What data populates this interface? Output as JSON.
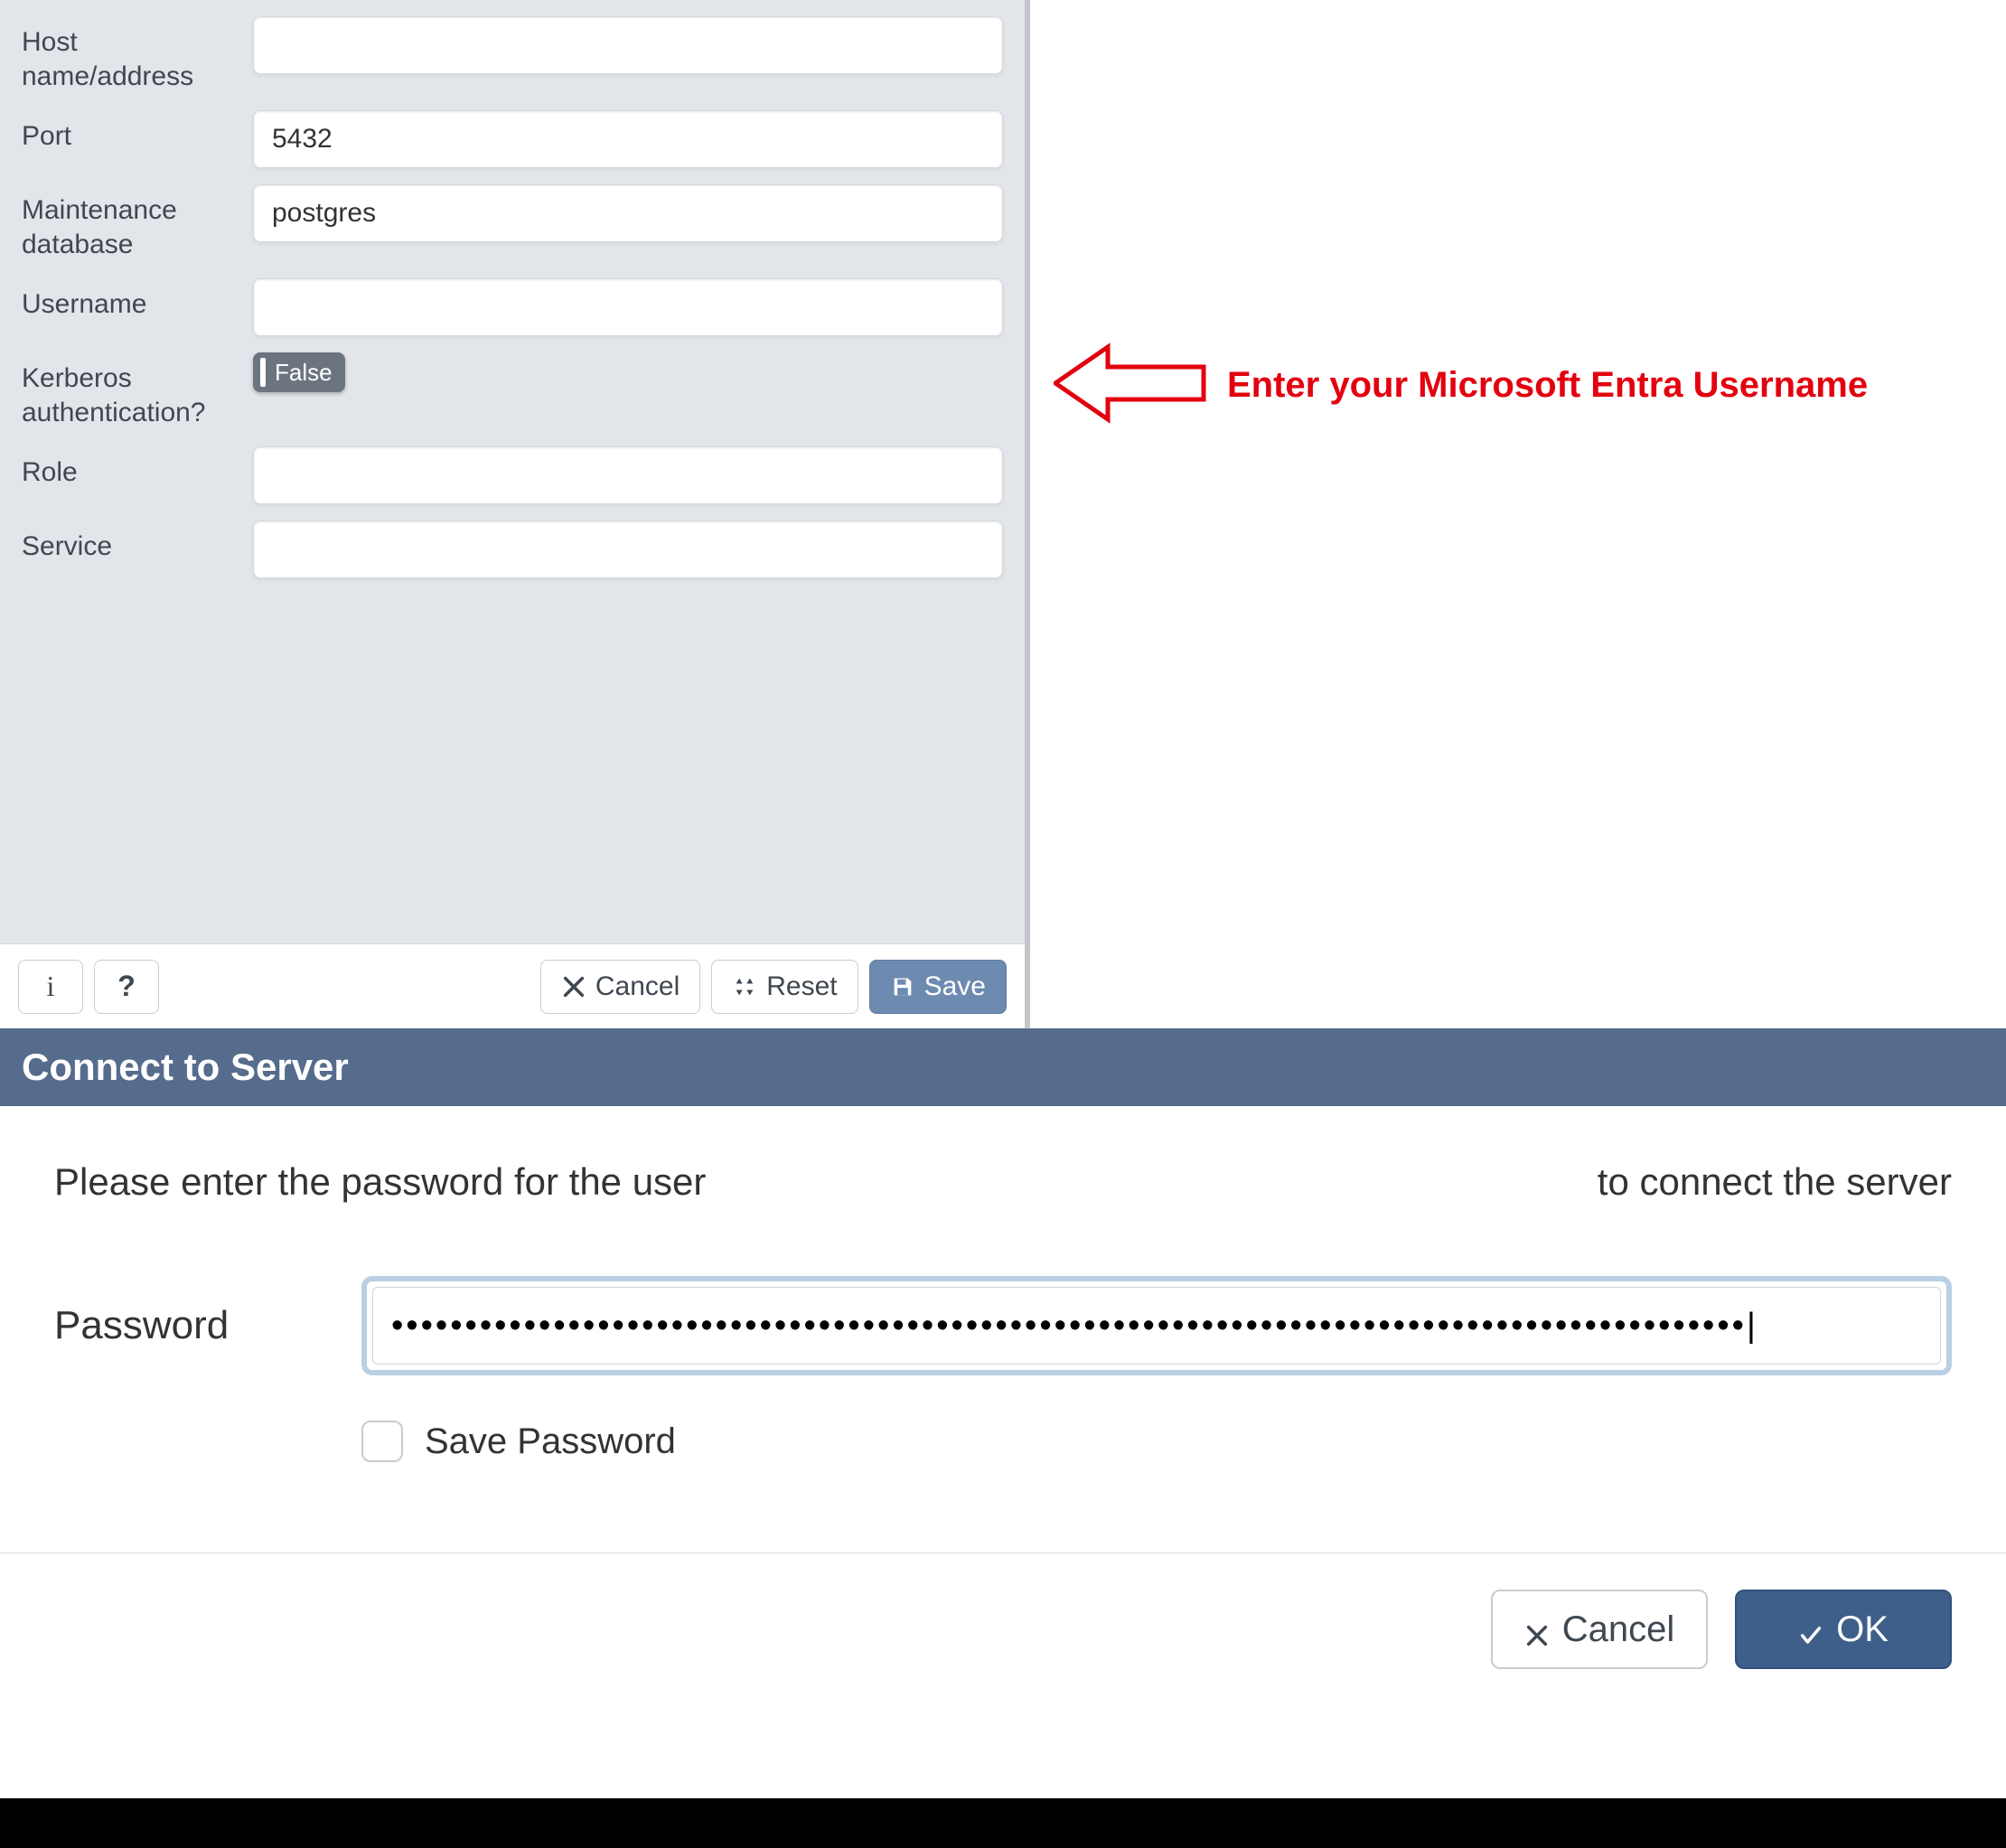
{
  "serverForm": {
    "labels": {
      "host": "Host name/address",
      "port": "Port",
      "maintDb": "Maintenance database",
      "username": "Username",
      "kerberos": "Kerberos authentication?",
      "role": "Role",
      "service": "Service"
    },
    "values": {
      "host": "",
      "port": "5432",
      "maintDb": "postgres",
      "username": "",
      "kerberosToggle": "False",
      "role": "",
      "service": ""
    },
    "actions": {
      "cancel": "Cancel",
      "reset": "Reset",
      "save": "Save"
    },
    "iconButtons": {
      "info": "i",
      "help": "?"
    }
  },
  "annotation": {
    "text": "Enter your Microsoft Entra Username",
    "arrowColor": "#e3000f"
  },
  "connectDialog": {
    "title": "Connect to Server",
    "messagePrefix": "Please enter the password for the user",
    "messageSuffix": "to connect the server",
    "passwordLabel": "Password",
    "passwordValue": "••••••••••••••••••••••••••••••••••••••••••••••••••••••••••••••••••••••••••••••••••••••••••••|",
    "savePasswordLabel": "Save Password",
    "buttons": {
      "cancel": "Cancel",
      "ok": "OK"
    }
  }
}
